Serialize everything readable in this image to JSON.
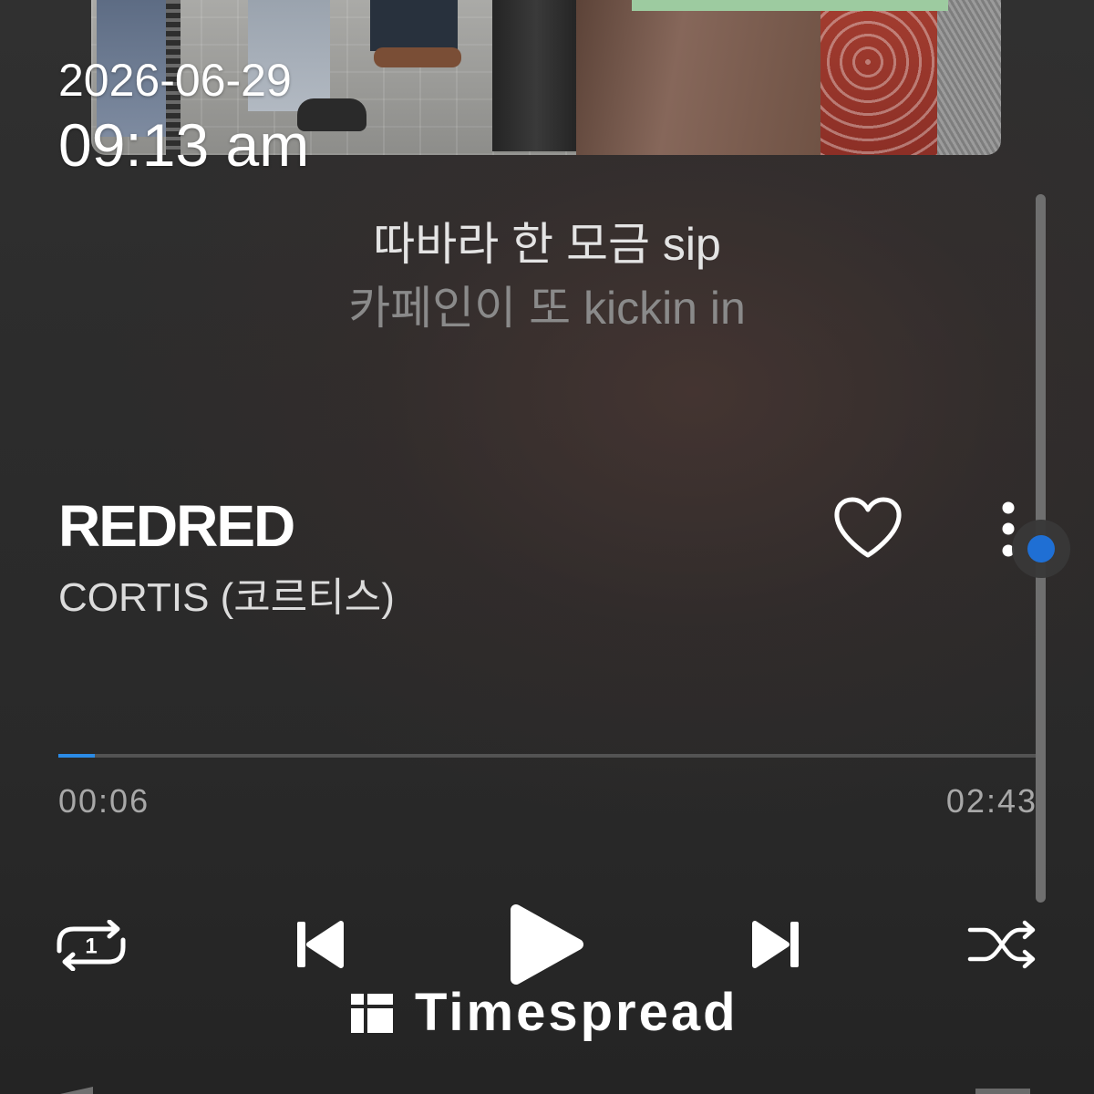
{
  "status": {
    "date": "2026-06-29",
    "time": "09:13 am"
  },
  "lyrics": {
    "current_line": "따바라 한 모금 sip",
    "next_line": "카페인이 또 kickin in"
  },
  "track": {
    "title": "REDRED",
    "artist": "CORTIS (코르티스)",
    "liked": false
  },
  "playback": {
    "elapsed": "00:06",
    "duration": "02:43",
    "progress_fraction": 0.037,
    "is_playing": false,
    "repeat_badge": "1"
  },
  "scrollbar": {
    "position_fraction": 0.5
  },
  "watermark": {
    "text": "Timespread"
  },
  "icons": {
    "like": "heart-outline-icon",
    "more": "more-vertical-icon",
    "repeat": "repeat-one-icon",
    "previous": "skip-previous-icon",
    "play": "play-icon",
    "next": "skip-next-icon",
    "shuffle": "shuffle-icon",
    "watermark_logo": "timespread-logo-icon"
  },
  "colors": {
    "accent": "#2b8be6",
    "scroll_handle": "#1f6fd4",
    "text_primary": "#ffffff",
    "text_secondary": "#a8a8a8",
    "lyric_inactive": "#8a8a8a",
    "background": "#2a2a2a"
  }
}
